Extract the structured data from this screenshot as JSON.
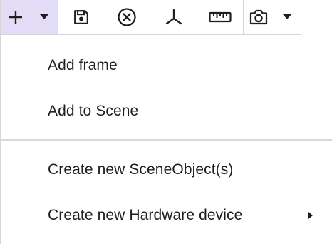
{
  "toolbar": {
    "buttons": [
      {
        "icon": "plus-icon",
        "active": true
      },
      {
        "icon": "chevron-down-icon",
        "active": true
      },
      {
        "icon": "save-icon"
      },
      {
        "icon": "close-circle-icon"
      },
      {
        "icon": "axes-icon"
      },
      {
        "icon": "ruler-icon"
      },
      {
        "icon": "camera-icon"
      },
      {
        "icon": "chevron-down-icon"
      }
    ],
    "active_color": "#e3dcf7",
    "border_color": "#d6d6d6"
  },
  "menu": {
    "items": [
      {
        "label": "Add frame"
      },
      {
        "label": "Add to Scene"
      },
      {
        "label": "Create new SceneObject(s)"
      },
      {
        "label": "Create new Hardware device",
        "has_submenu": true,
        "submenu_icon": "chevron-right-icon"
      }
    ]
  }
}
